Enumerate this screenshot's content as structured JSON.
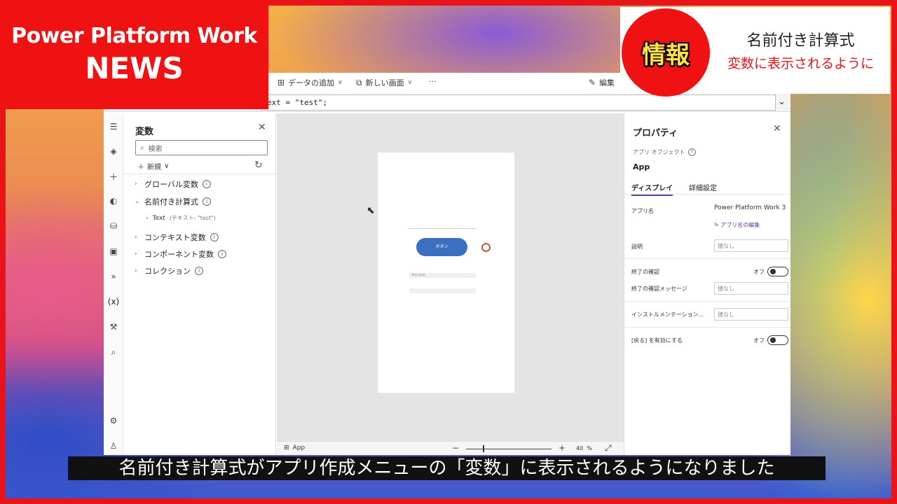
{
  "banner": {
    "line1": "Power Platform Work",
    "line2": "NEWS"
  },
  "info_card": {
    "badge": "情報",
    "title": "名前付き計算式",
    "subtitle": "変数に表示されるように"
  },
  "toolbar": {
    "add_data": "データの追加",
    "new_screen": "新しい画面",
    "more": "···",
    "edit": "編集"
  },
  "formula": {
    "text": "ext = \"test\";"
  },
  "variables_panel": {
    "title": "変数",
    "search_placeholder": "検索",
    "new_label": "新規",
    "items": [
      {
        "label": "グローバル変数"
      },
      {
        "label": "名前付き計算式"
      },
      {
        "label": "コンテキスト変数"
      },
      {
        "label": "コンポーネント変数"
      },
      {
        "label": "コレクション"
      }
    ],
    "sub_item": {
      "name": "Text",
      "detail": "(テキスト: \"test\")"
    }
  },
  "canvas": {
    "button_label": "ボタン",
    "input_text": "Text input"
  },
  "status_bar": {
    "screen": "App",
    "zoom": "40",
    "zoom_unit": "%"
  },
  "properties": {
    "title": "プロパティ",
    "object_type": "アプリ オブジェクト",
    "object_name": "App",
    "tabs": [
      "ディスプレイ",
      "詳細設定"
    ],
    "app_name_label": "アプリ名",
    "app_name_value": "Power Platform Work 3",
    "edit_app_name": "アプリ名の編集",
    "description_label": "説明",
    "description_placeholder": "値なし",
    "confirm_exit_label": "終了の確認",
    "confirm_exit_state": "オフ",
    "confirm_exit_msg_label": "終了の確認メッセージ",
    "confirm_exit_msg_placeholder": "値なし",
    "instrumentation_label": "インストルメンテーション...",
    "instrumentation_placeholder": "値なし",
    "enable_back_label": "[戻る] を有効にする",
    "enable_back_state": "オフ"
  },
  "caption": "名前付き計算式がアプリ作成メニューの「変数」に表示されるようになりました"
}
